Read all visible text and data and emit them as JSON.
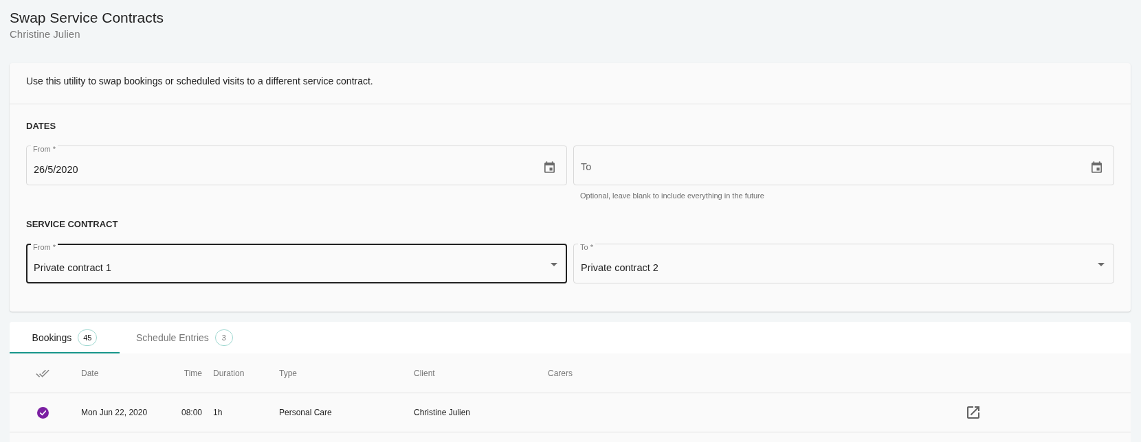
{
  "page": {
    "title": "Swap Service Contracts",
    "subtitle": "Christine Julien"
  },
  "intro": "Use this utility to swap bookings or scheduled visits to a different service contract.",
  "dates": {
    "heading": "DATES",
    "fields": [
      {
        "label": "From *",
        "value": "26/5/2020"
      },
      {
        "placeholder": "To",
        "helper": "Optional, leave blank to include everything in the future"
      }
    ]
  },
  "service_contract": {
    "heading": "SERVICE CONTRACT",
    "fields": [
      {
        "label": "From *",
        "value": "Private contract 1",
        "focused": true
      },
      {
        "label": "To *",
        "value": "Private contract 2",
        "focused": false
      }
    ]
  },
  "tabs": [
    {
      "label": "Bookings",
      "count": "45",
      "selected": true
    },
    {
      "label": "Schedule Entries",
      "count": "3",
      "selected": false
    }
  ],
  "table": {
    "columns": [
      "Date",
      "Time",
      "Duration",
      "Type",
      "Client",
      "Carers"
    ],
    "rows": [
      {
        "selected": true,
        "cells": [
          "Mon Jun 22, 2020",
          "08:00",
          "1h",
          "Personal Care",
          "Christine Julien"
        ]
      }
    ]
  }
}
